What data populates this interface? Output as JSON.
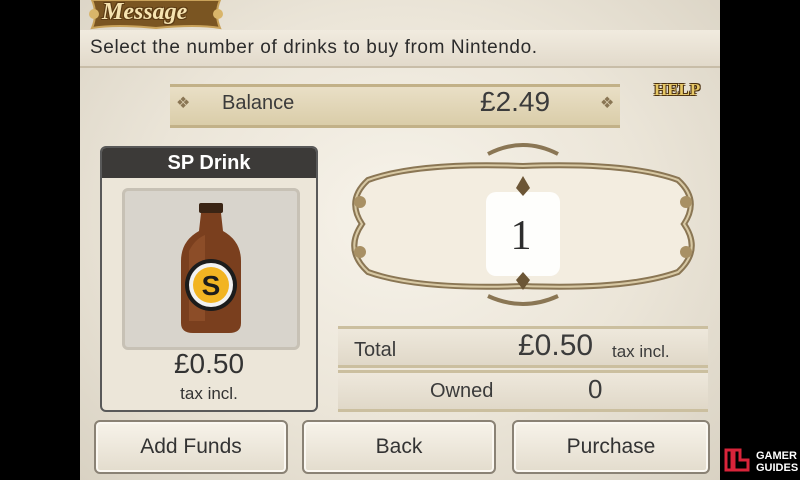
{
  "message": {
    "title": "Message",
    "text": "Select the number of drinks to buy from Nintendo."
  },
  "balance": {
    "label": "Balance",
    "value": "£2.49"
  },
  "help": "HELP",
  "item": {
    "name": "SP Drink",
    "icon": "bottle-icon",
    "badge_letter": "S",
    "price": "£0.50",
    "tax_note": "tax incl."
  },
  "quantity": "1",
  "summary": {
    "total_label": "Total",
    "total_value": "£0.50",
    "total_tax": "tax incl.",
    "owned_label": "Owned",
    "owned_value": "0"
  },
  "buttons": {
    "add_funds": "Add Funds",
    "back": "Back",
    "purchase": "Purchase"
  },
  "watermark": {
    "line1": "GAMER",
    "line2": "GUIDES"
  },
  "colors": {
    "gold": "#e6c766",
    "dark_header": "#3c3a38",
    "bottle": "#7a3f1e",
    "badge": "#f2b422"
  }
}
